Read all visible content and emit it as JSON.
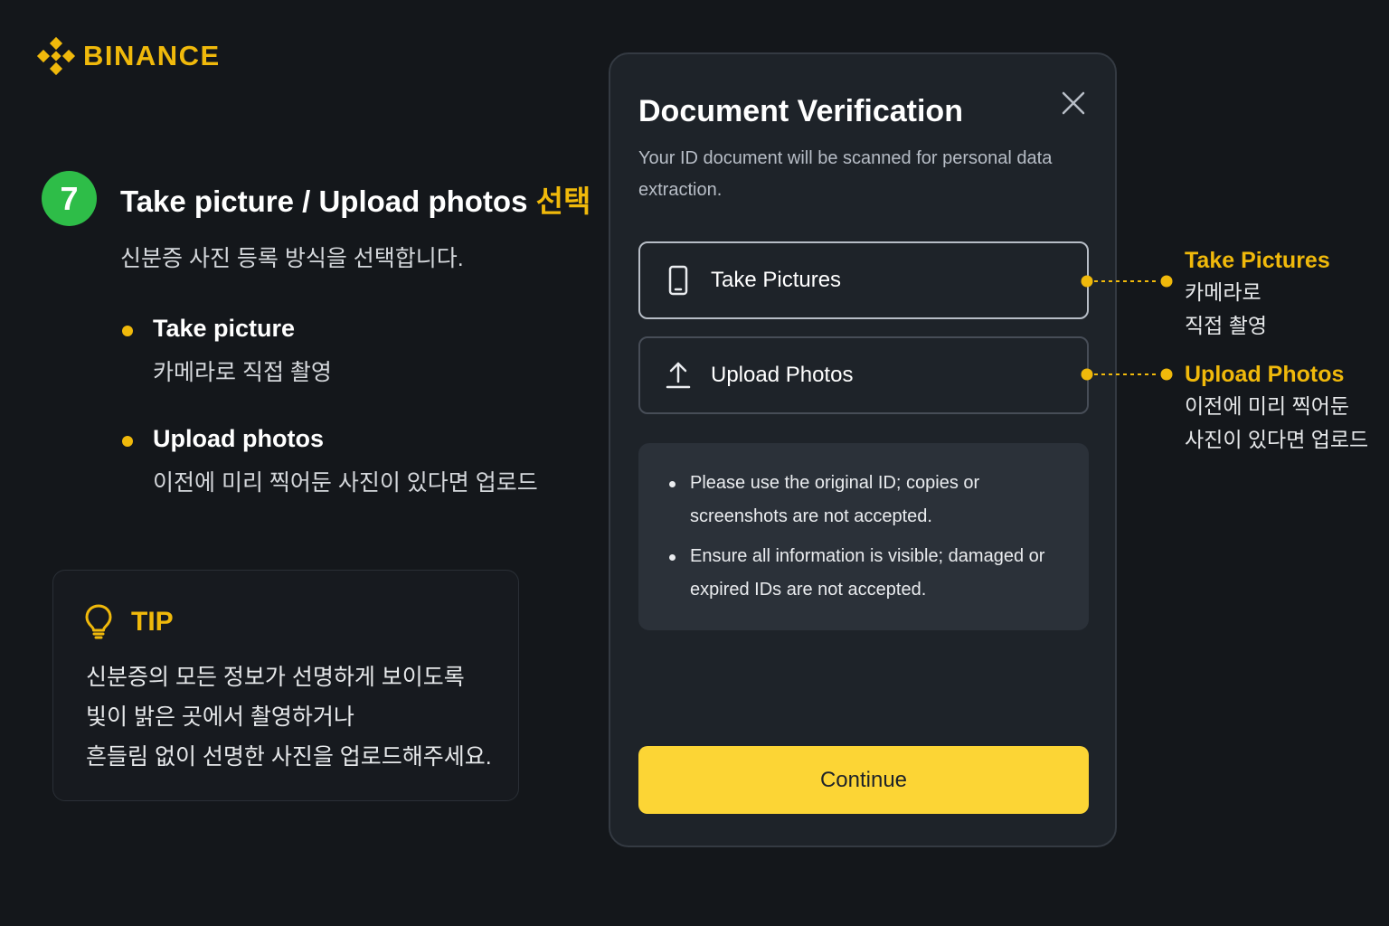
{
  "brand": {
    "name": "BINANCE",
    "color": "#f0b90b"
  },
  "step": {
    "number": "7",
    "title_main": "Take picture / Upload photos ",
    "title_highlight": "선택",
    "description": "신분증 사진 등록 방식을 선택합니다.",
    "options": [
      {
        "title": "Take picture",
        "desc": "카메라로 직접 촬영"
      },
      {
        "title": "Upload photos",
        "desc": "이전에 미리 찍어둔 사진이 있다면 업로드"
      }
    ]
  },
  "tip": {
    "label": "TIP",
    "lines": [
      "신분증의 모든 정보가 선명하게 보이도록",
      "빛이 밝은 곳에서 촬영하거나",
      "흔들림 없이 선명한 사진을 업로드해주세요."
    ]
  },
  "modal": {
    "title": "Document Verification",
    "subtitle": "Your ID document will be scanned for personal data extraction.",
    "options": [
      {
        "label": "Take Pictures",
        "icon": "phone-icon"
      },
      {
        "label": "Upload Photos",
        "icon": "upload-icon"
      }
    ],
    "notes": [
      "Please use the original ID; copies or screenshots are not accepted.",
      "Ensure all information is visible; damaged or expired IDs are not accepted."
    ],
    "continue_label": "Continue"
  },
  "callouts": [
    {
      "title": "Take Pictures",
      "lines": [
        "카메라로",
        "직접 촬영"
      ]
    },
    {
      "title": "Upload Photos",
      "lines": [
        "이전에 미리 찍어둔",
        "사진이 있다면 업로드"
      ]
    }
  ],
  "colors": {
    "background": "#14171b",
    "accent": "#f0b90b",
    "button": "#fcd535",
    "step_badge": "#2ebd48",
    "modal": "#1e2329"
  }
}
